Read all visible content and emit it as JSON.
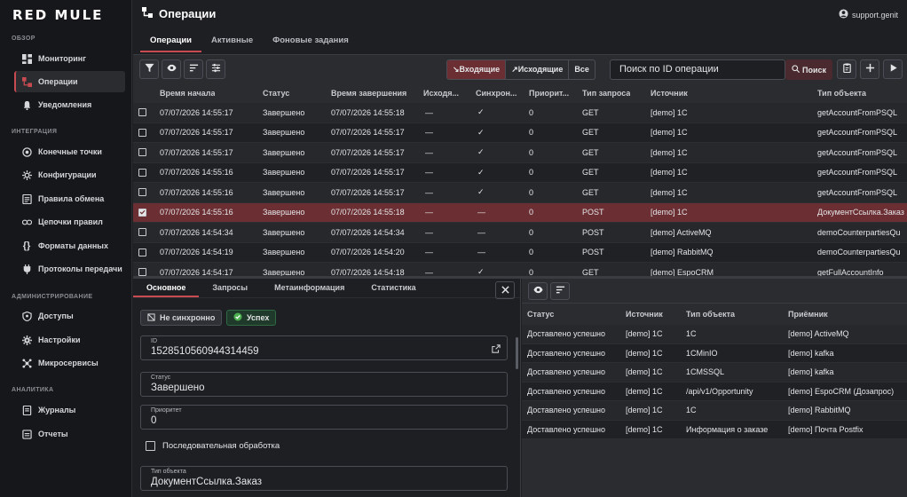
{
  "app": {
    "logo": "RED MULE",
    "page_title": "Операции",
    "user": "support.genit"
  },
  "sidebar": {
    "sections": [
      {
        "title": "ОБЗОР"
      },
      {
        "title": "ИНТЕГРАЦИЯ"
      },
      {
        "title": "АДМИНИСТРИРОВАНИЕ"
      },
      {
        "title": "АНАЛИТИКА"
      }
    ],
    "items": [
      {
        "label": "Мониторинг",
        "icon": "dashboard-icon"
      },
      {
        "label": "Операции",
        "icon": "operations-icon"
      },
      {
        "label": "Уведомления",
        "icon": "bell-icon"
      },
      {
        "label": "Конечные точки",
        "icon": "endpoint-icon"
      },
      {
        "label": "Конфигурации",
        "icon": "config-icon"
      },
      {
        "label": "Правила обмена",
        "icon": "rules-icon"
      },
      {
        "label": "Цепочки правил",
        "icon": "chain-icon"
      },
      {
        "label": "Форматы данных",
        "icon": "braces-icon"
      },
      {
        "label": "Протоколы передачи",
        "icon": "plug-icon"
      },
      {
        "label": "Доступы",
        "icon": "shield-icon"
      },
      {
        "label": "Настройки",
        "icon": "gear-icon"
      },
      {
        "label": "Микросервисы",
        "icon": "microservice-icon"
      },
      {
        "label": "Журналы",
        "icon": "journal-icon"
      },
      {
        "label": "Отчеты",
        "icon": "report-icon"
      }
    ]
  },
  "tabs": [
    {
      "label": "Операции"
    },
    {
      "label": "Активные"
    },
    {
      "label": "Фоновые задания"
    }
  ],
  "toolbar": {
    "direction_filters": [
      {
        "label": "↘Входящие"
      },
      {
        "label": "↗Исходящие"
      },
      {
        "label": "Все"
      }
    ],
    "search_placeholder": "Поиск по ID операции",
    "search_button": "Поиск"
  },
  "table": {
    "columns": [
      "Время начала",
      "Статус",
      "Время завершения",
      "Исходя...",
      "Синхрон...",
      "Приорит...",
      "Тип запроса",
      "Источник",
      "Тип объекта"
    ],
    "rows": [
      {
        "start": "07/07/2026 14:55:17",
        "status": "Завершено",
        "end": "07/07/2026 14:55:18",
        "out": "—",
        "sync": "✓",
        "priority": "0",
        "method": "GET",
        "source": "[demo] 1C",
        "object": "getAccountFromPSQL"
      },
      {
        "start": "07/07/2026 14:55:17",
        "status": "Завершено",
        "end": "07/07/2026 14:55:17",
        "out": "—",
        "sync": "✓",
        "priority": "0",
        "method": "GET",
        "source": "[demo] 1C",
        "object": "getAccountFromPSQL"
      },
      {
        "start": "07/07/2026 14:55:17",
        "status": "Завершено",
        "end": "07/07/2026 14:55:17",
        "out": "—",
        "sync": "✓",
        "priority": "0",
        "method": "GET",
        "source": "[demo] 1C",
        "object": "getAccountFromPSQL"
      },
      {
        "start": "07/07/2026 14:55:16",
        "status": "Завершено",
        "end": "07/07/2026 14:55:17",
        "out": "—",
        "sync": "✓",
        "priority": "0",
        "method": "GET",
        "source": "[demo] 1C",
        "object": "getAccountFromPSQL"
      },
      {
        "start": "07/07/2026 14:55:16",
        "status": "Завершено",
        "end": "07/07/2026 14:55:17",
        "out": "—",
        "sync": "✓",
        "priority": "0",
        "method": "GET",
        "source": "[demo] 1C",
        "object": "getAccountFromPSQL"
      },
      {
        "start": "07/07/2026 14:55:16",
        "status": "Завершено",
        "end": "07/07/2026 14:55:18",
        "out": "—",
        "sync": "—",
        "priority": "0",
        "method": "POST",
        "source": "[demo] 1C",
        "object": "ДокументСсылка.Заказ"
      },
      {
        "start": "07/07/2026 14:54:34",
        "status": "Завершено",
        "end": "07/07/2026 14:54:34",
        "out": "—",
        "sync": "—",
        "priority": "0",
        "method": "POST",
        "source": "[demo] ActiveMQ",
        "object": "demoCounterpartiesQu"
      },
      {
        "start": "07/07/2026 14:54:19",
        "status": "Завершено",
        "end": "07/07/2026 14:54:20",
        "out": "—",
        "sync": "—",
        "priority": "0",
        "method": "POST",
        "source": "[demo] RabbitMQ",
        "object": "demoCounterpartiesQu"
      },
      {
        "start": "07/07/2026 14:54:17",
        "status": "Завершено",
        "end": "07/07/2026 14:54:18",
        "out": "—",
        "sync": "✓",
        "priority": "0",
        "method": "GET",
        "source": "[demo] EspoCRM",
        "object": "getFullAccountInfo"
      }
    ]
  },
  "details": {
    "tabs": [
      {
        "label": "Основное"
      },
      {
        "label": "Запросы"
      },
      {
        "label": "Метаинформация"
      },
      {
        "label": "Статистика"
      }
    ],
    "chip_sync": "Не синхронно",
    "chip_success": "Успех",
    "id_label": "ID",
    "id_value": "1528510560944314459",
    "status_label": "Статус",
    "status_value": "Завершено",
    "priority_label": "Приоритет",
    "priority_value": "0",
    "sequential_label": "Последовательная обработка",
    "object_label": "Тип объекта",
    "object_value": "ДокументСсылка.Заказ"
  },
  "deliveries": {
    "columns": [
      "Статус",
      "Источник",
      "Тип объекта",
      "Приёмник"
    ],
    "rows": [
      {
        "status": "Доставлено успешно",
        "source": "[demo] 1C",
        "object": "1C",
        "target": "[demo] ActiveMQ"
      },
      {
        "status": "Доставлено успешно",
        "source": "[demo] 1C",
        "object": "1CMinIO",
        "target": "[demo] kafka"
      },
      {
        "status": "Доставлено успешно",
        "source": "[demo] 1C",
        "object": "1CMSSQL",
        "target": "[demo] kafka"
      },
      {
        "status": "Доставлено успешно",
        "source": "[demo] 1C",
        "object": "/api/v1/Opportunity",
        "target": "[demo] EspoCRM (Дозапрос)"
      },
      {
        "status": "Доставлено успешно",
        "source": "[demo] 1C",
        "object": "1C",
        "target": "[demo] RabbitMQ"
      },
      {
        "status": "Доставлено успешно",
        "source": "[demo] 1C",
        "object": "Информация о заказе",
        "target": "[demo] Почта Postfix"
      }
    ]
  },
  "colors": {
    "accent": "#c84b52",
    "selected_row": "#6b2e33",
    "success": "#4caf50"
  }
}
